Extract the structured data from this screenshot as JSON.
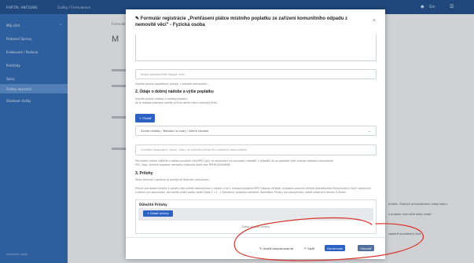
{
  "topbar": {
    "brand": "PORTÁL ANČSOBE",
    "subtitle": "Služby / Formulárové",
    "user": "Šim",
    "menu_icon": "☰"
  },
  "sidebar": {
    "items": [
      {
        "label": "Môj účet"
      },
      {
        "label": "Podanie/ Správy"
      },
      {
        "label": "Evidované / Podanie"
      },
      {
        "label": "Prehľady"
      },
      {
        "label": "Spisy"
      },
      {
        "label": "Služby obyvateľ"
      },
      {
        "label": "Dávkové služby"
      }
    ],
    "footer": "Zakladné údaje"
  },
  "background": {
    "crumb": "Formuláre",
    "heading": "M"
  },
  "modal": {
    "title": "Formulár registrácie „Prehľásení plátce místního poplatku ze zařízení komunitního odpadu z nemovitě věci\" - Fyzická osoba",
    "close": "×",
    "fields": {
      "variable_symbol_placeholder": "Nebol poplatek/Váš Veggie vedy",
      "variable_symbol_hint": "Vyplňte prosím poplatkový symbol, v prípade aktivováne..."
    },
    "section2": {
      "title": "2. Údaje o dobrej nádobe a výšie poplatku",
      "hint1": "Vyplňte prosím nádoby a nádoby/rozsahu.",
      "hint2": "Ak je nádoba zdieľaná uvedte aj čísla zdieľa ného nemovitý Prehl.",
      "add_button": "+ Pridať",
      "select_value": "Zvolte nádoby / Nádobu na vody / Zdieľa nádobe",
      "input_placeholder": "Umístění zakoupení (ulice), číslo, ze zemněny/číslo Pro zohlednit komunikální ",
      "long_hint1": "Pro složení vašich zjištěné a nádob vycváníh (ulici/PSČ) a(k) ze zpracování na související nádobě. V případě, že se poplatek týká svazuje nádobou nemovitostí",
      "long_hint2": "PSČ, číslo, uložené popsane nemovity místnosti podle bez PREHĽADOVÁNIE."
    },
    "section3": {
      "title": "3. Prílohy",
      "hint": "Tento formulár i oprávne je poskytnúť formulár uchovaním..."
    },
    "long_text1": "Prosím pre dodaní prílohy k pohybu ako súčasť dokumentov 1 mesiac a do 1 mesiaca podania MPS Súborov veľkosti, prípadne povinné veľkosť jednotkového Poskytnutých iných vstupných",
    "long_text2": "a datum pre zákonnosti, ako každá vrátili podľa úradu Doba 1 v 1 - 1 Tolerance, prípadne poistené. Konkrétne. Prílohy pre poskytnutia, každé oddaných dôvod: 6 Zmien.",
    "attachments": {
      "header": "Dôležité Prílohy",
      "add_button": "+ Dodať prílohy",
      "empty": "Zatiaľ žiadne prílohy"
    },
    "footer": {
      "save_draft": "Uložiť rozpracovanie",
      "back": "Späť",
      "generate": "Generovat",
      "send": "Odoslať"
    }
  },
  "background_right": {
    "line1": "prílohu. Poskytň plnohodnotne údaje kópiu.",
    "line2": "v prípade nemusíte daky vedať",
    "line3": "zaplatiť poplatkový kód."
  },
  "annotation_color": "#d9342b"
}
